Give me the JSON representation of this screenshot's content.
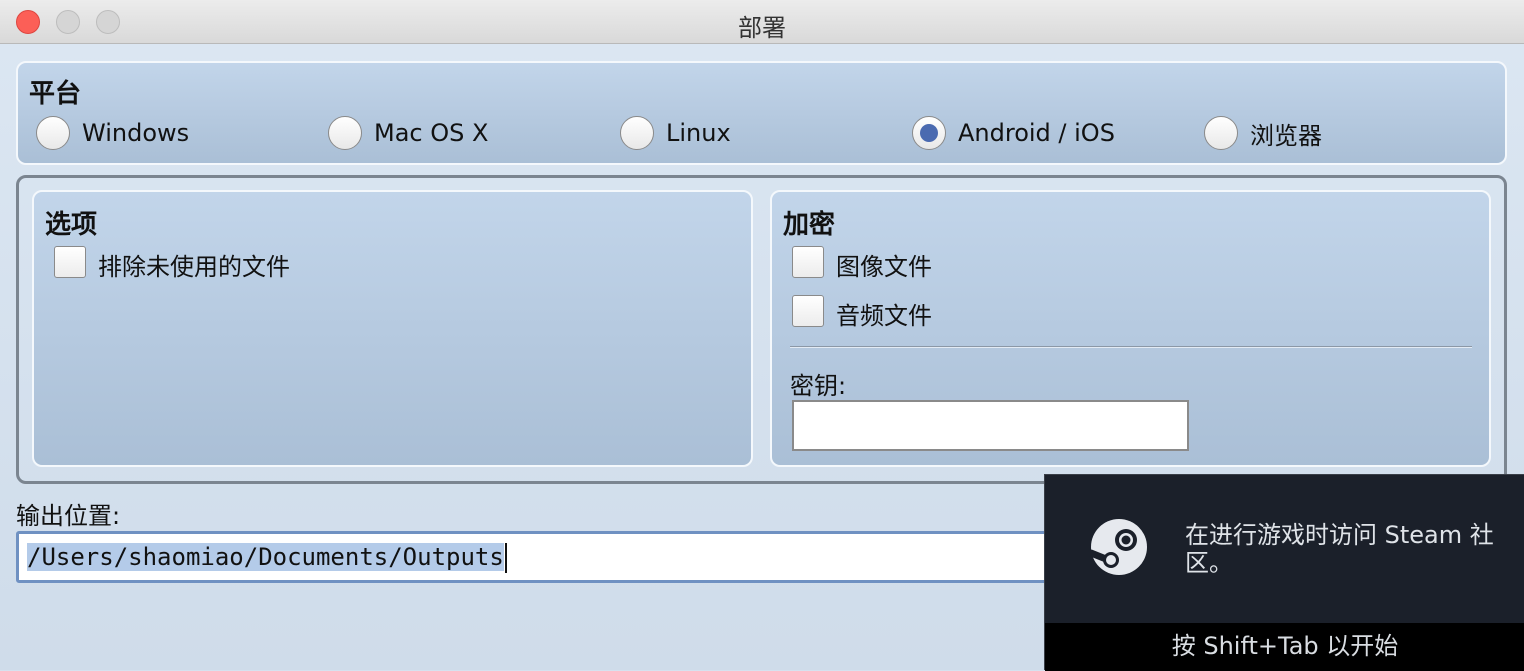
{
  "window": {
    "title": "部署"
  },
  "platform": {
    "title": "平台",
    "options": [
      {
        "label": "Windows",
        "selected": false
      },
      {
        "label": "Mac OS X",
        "selected": false
      },
      {
        "label": "Linux",
        "selected": false
      },
      {
        "label": "Android / iOS",
        "selected": true
      },
      {
        "label": "浏览器",
        "selected": false
      }
    ]
  },
  "options_group": {
    "title": "选项",
    "exclude_unused": {
      "label": "排除未使用的文件",
      "checked": false
    }
  },
  "encryption": {
    "title": "加密",
    "image_files": {
      "label": "图像文件",
      "checked": false
    },
    "audio_files": {
      "label": "音频文件",
      "checked": false
    },
    "key_label": "密钥:",
    "key_value": ""
  },
  "output": {
    "label": "输出位置:",
    "path": "/Users/shaomiao/Documents/Outputs"
  },
  "steam_overlay": {
    "message": "在进行游戏时访问 Steam 社区。",
    "hint": "按 Shift+Tab 以开始"
  }
}
